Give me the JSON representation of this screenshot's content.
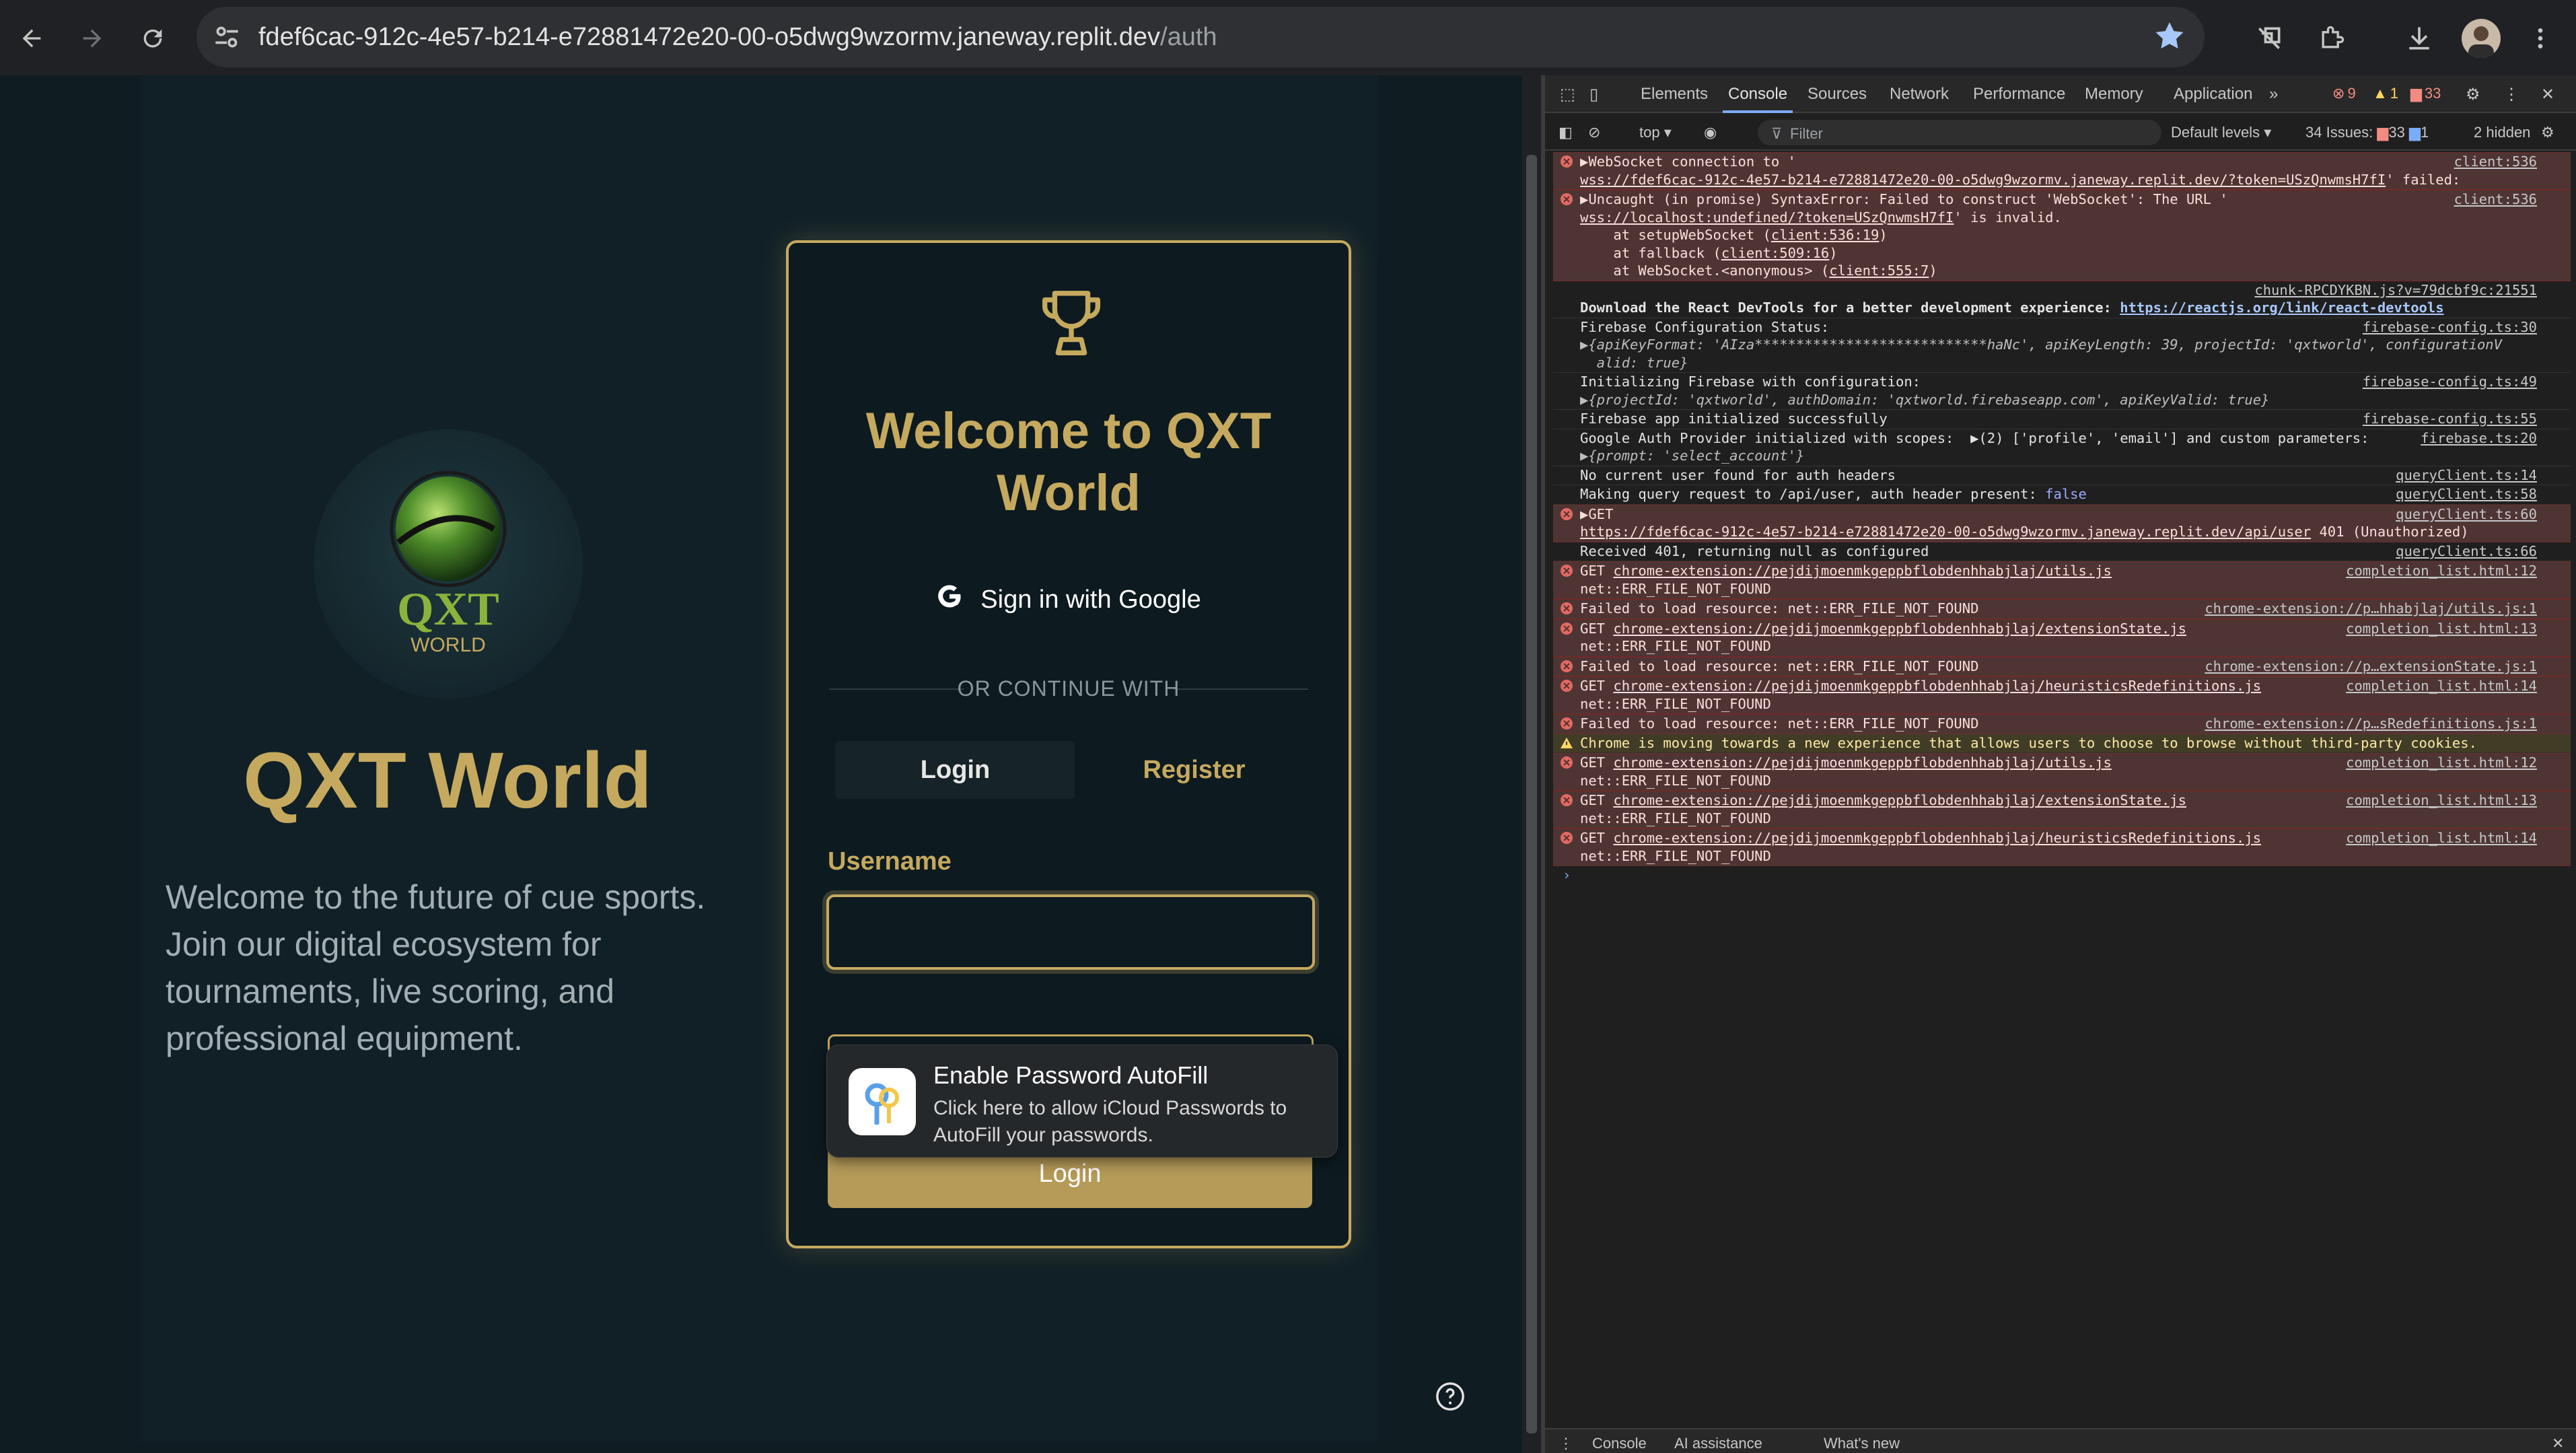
{
  "browser": {
    "url_host": "fdef6cac-912c-4e57-b214-e72881472e20-00-o5dwg9wzormv.janeway.replit.dev",
    "url_path": "/auth"
  },
  "page": {
    "brand_logo_text": "QXT",
    "brand_logo_subtext": "WORLD",
    "hero_title": "QXT World",
    "hero_description": "Welcome to the future of cue sports. Join our digital ecosystem for tournaments, live scoring, and professional equipment.",
    "card": {
      "welcome": "Welcome to QXT World",
      "google_button": "Sign in with Google",
      "divider_text": "OR CONTINUE WITH",
      "tab_login": "Login",
      "tab_register": "Register",
      "username_label": "Username",
      "username_value": "",
      "submit": "Login"
    },
    "autofill": {
      "title": "Enable Password AutoFill",
      "description": "Click here to allow iCloud Passwords to AutoFill your passwords."
    }
  },
  "devtools": {
    "tabs": [
      "Elements",
      "Console",
      "Sources",
      "Network",
      "Performance",
      "Memory",
      "Application"
    ],
    "active_tab": "Console",
    "error_count": "9",
    "warning_count": "1",
    "info_count": "33",
    "toolbar": {
      "context": "top",
      "filter_placeholder": "Filter",
      "levels": "Default levels",
      "issues_label": "34 Issues:",
      "issues_a": "33",
      "issues_b": "1",
      "hidden": "2 hidden"
    },
    "drawer_tabs": [
      "Console",
      "AI assistance",
      "What's new"
    ],
    "messages": {
      "m1a": "▶WebSocket connection to '",
      "m1b": "wss://fdef6cac-912c-4e57-b214-e72881472e20-00-o5dwg9wzormv.janeway.replit.dev/?token=USzQnwmsH7fI",
      "m1c": "' failed:",
      "m1src": "client:536",
      "m2a": "▶Uncaught (in promise) SyntaxError: Failed to construct 'WebSocket': The URL '",
      "m2b": "wss://localhost:undefined/?token=USzQnwmsH7fI",
      "m2c": "' is invalid.",
      "m2src": "client:536",
      "m2l1a": "    at setupWebSocket (",
      "m2l1b": "client:536:19",
      "m2l2a": "    at fallback (",
      "m2l2b": "client:509:16",
      "m2l3a": "    at WebSocket.<anonymous> (",
      "m2l3b": "client:555:7",
      "m3src": "chunk-RPCDYKBN.js?v=79dcbf9c:21551",
      "m3a": "Download the React DevTools for a better development experience: ",
      "m3b": "https://reactjs.org/link/react-devtools",
      "m4a": "Firebase Configuration Status:",
      "m4src": "firebase-config.ts:30",
      "m4b": "▶{apiKeyFormat: 'AIza****************************haNc', apiKeyLength: 39, projectId: 'qxtworld', configurationV",
      "m4c": "  alid: true}",
      "m5a": "Initializing Firebase with configuration:",
      "m5src": "firebase-config.ts:49",
      "m5b": "▶{projectId: 'qxtworld', authDomain: 'qxtworld.firebaseapp.com', apiKeyValid: true}",
      "m6a": "Firebase app initialized successfully",
      "m6src": "firebase-config.ts:55",
      "m7a": "Google Auth Provider initialized with scopes:  ▶(2) ['profile', 'email'] and custom parameters:",
      "m7src": "firebase.ts:20",
      "m7b": "▶{prompt: 'select_account'}",
      "m8a": "No current user found for auth headers",
      "m8src": "queryClient.ts:14",
      "m9a": "Making query request to /api/user, auth header present: ",
      "m9b": "false",
      "m9src": "queryClient.ts:58",
      "m10a": "▶GET",
      "m10src": "queryClient.ts:60",
      "m10b": "https://fdef6cac-912c-4e57-b214-e72881472e20-00-o5dwg9wzormv.janeway.replit.dev/api/user",
      "m10c": " 401 (Unauthorized)",
      "m11a": "Received 401, returning null as configured",
      "m11src": "queryClient.ts:66",
      "m12a": "GET ",
      "m12b": "chrome-extension://pejdijmoenmkgeppbflobdenhhabjlaj/utils.js",
      "m12c": "net::ERR_FILE_NOT_FOUND",
      "m12src": "completion_list.html:12",
      "m13a": "Failed to load resource: net::ERR_FILE_NOT_FOUND",
      "m13src": "chrome-extension://p…hhabjlaj/utils.js:1",
      "m14b": "chrome-extension://pejdijmoenmkgeppbflobdenhhabjlaj/extensionState.js",
      "m14src": "completion_list.html:13",
      "m15src": "chrome-extension://p…extensionState.js:1",
      "m16b": "chrome-extension://pejdijmoenmkgeppbflobdenhhabjlaj/heuristicsRedefinitions.js",
      "m16src": "completion_list.html:14",
      "m17src": "chrome-extension://p…sRedefinitions.js:1",
      "m18a": "Chrome is moving towards a new experience that allows users to choose to browse without third-party cookies."
    }
  }
}
